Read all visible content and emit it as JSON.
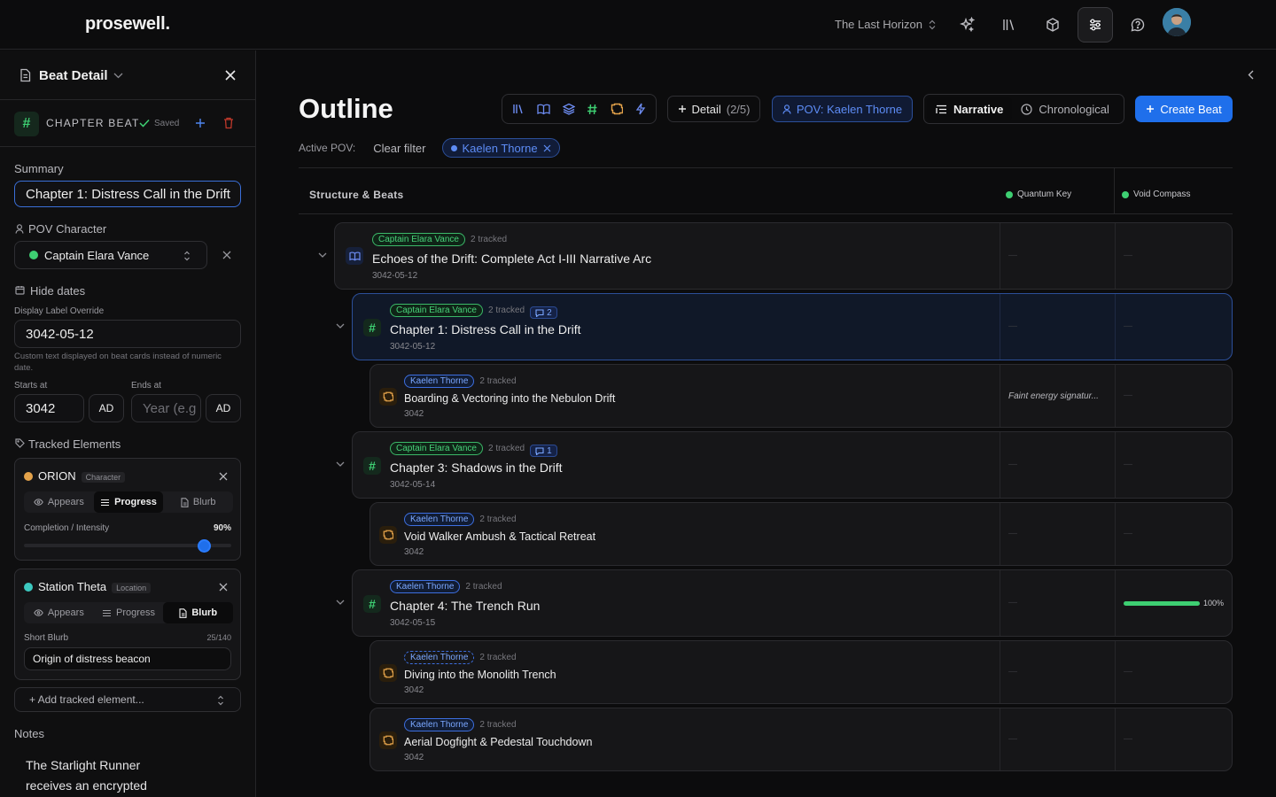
{
  "header": {
    "logo": "prosewell.",
    "project": "The Last Horizon",
    "icons": [
      "sparkle-icon",
      "library-icon",
      "cube-icon",
      "settings-sliders-icon",
      "help-icon"
    ]
  },
  "sidebar": {
    "title": "Beat Detail",
    "beat_type": "CHAPTER BEAT",
    "saved": "Saved",
    "summary_label": "Summary",
    "summary_value": "Chapter 1: Distress Call in the Drift",
    "pov_label": "POV Character",
    "pov_value": "Captain Elara Vance",
    "hide_dates": "Hide dates",
    "display_label": "Display Label Override",
    "display_value": "3042-05-12",
    "display_help": "Custom text displayed on beat cards instead of numeric date.",
    "starts_label": "Starts at",
    "starts_value": "3042",
    "starts_era": "AD",
    "ends_label": "Ends at",
    "ends_placeholder": "Year (e.g",
    "ends_era": "AD",
    "tracked_label": "Tracked Elements",
    "tracked": [
      {
        "name": "ORION",
        "type": "Character",
        "color": "#e3a24a",
        "tabs": [
          "Appears",
          "Progress",
          "Blurb"
        ],
        "active_tab": "Progress",
        "metric_label": "Completion / Intensity",
        "metric_value": "90%",
        "progress": 0.9
      },
      {
        "name": "Station Theta",
        "type": "Location",
        "color": "#3cc9c0",
        "tabs": [
          "Appears",
          "Progress",
          "Blurb"
        ],
        "active_tab": "Blurb",
        "metric_label": "Short Blurb",
        "metric_value": "25/140",
        "blurb": "Origin of distress beacon"
      }
    ],
    "add_tracked": "+ Add tracked element...",
    "notes_label": "Notes",
    "notes_line1": "The Starlight Runner",
    "notes_line2": "receives an encrypted"
  },
  "main": {
    "title": "Outline",
    "detail_label": "Detail",
    "detail_count": "(2/5)",
    "pov_button": "POV: Kaelen Thorne",
    "view_narrative": "Narrative",
    "view_chronological": "Chronological",
    "create": "Create Beat",
    "active_pov_label": "Active POV:",
    "clear_filter": "Clear filter",
    "pov_chip": "Kaelen Thorne",
    "structure_label": "Structure & Beats",
    "columns": [
      {
        "name": "Quantum Key",
        "color": "#3ecf72"
      },
      {
        "name": "Void Compass",
        "color": "#3ecf72"
      }
    ],
    "beats": [
      {
        "badge": "Captain Elara Vance",
        "tracked": "2 tracked",
        "title": "Echoes of the Drift: Complete Act I-III Narrative Arc",
        "date": "3042-05-12"
      },
      {
        "badge": "Captain Elara Vance",
        "tracked": "2 tracked",
        "comments": "2",
        "title": "Chapter 1: Distress Call in the Drift",
        "date": "3042-05-12"
      },
      {
        "badge": "Kaelen Thorne",
        "tracked": "2 tracked",
        "title": "Boarding & Vectoring into the Nebulon Drift",
        "date": "3042",
        "note": "Faint energy signatur..."
      },
      {
        "badge": "Captain Elara Vance",
        "tracked": "2 tracked",
        "comments": "1",
        "title": "Chapter 3: Shadows in the Drift",
        "date": "3042-05-14"
      },
      {
        "badge": "Kaelen Thorne",
        "tracked": "2 tracked",
        "title": "Void Walker Ambush & Tactical Retreat",
        "date": "3042"
      },
      {
        "badge": "Kaelen Thorne",
        "tracked": "2 tracked",
        "title": "Chapter 4: The Trench Run",
        "date": "3042-05-15",
        "progress_label": "100%",
        "progress": 1.0
      },
      {
        "badge": "Kaelen Thorne",
        "tracked": "2 tracked",
        "title": "Diving into the Monolith Trench",
        "date": "3042"
      },
      {
        "badge": "Kaelen Thorne",
        "tracked": "2 tracked",
        "title": "Aerial Dogfight & Pedestal Touchdown",
        "date": "3042"
      }
    ],
    "empty_cell": "—"
  }
}
